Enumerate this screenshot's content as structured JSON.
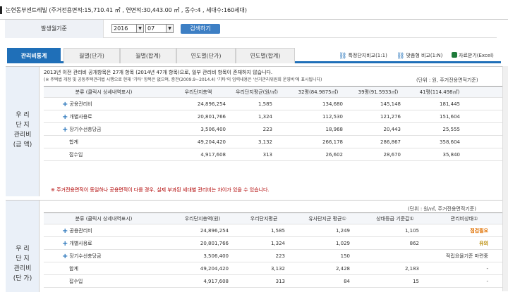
{
  "header": {
    "title": "논현동부센트레빌 (주거전용면적:15,710.41 ㎡ , 연면적:30,443.00 ㎡ , 동수:4 , 세대수:160세대)"
  },
  "filter": {
    "label": "발생월기준",
    "year": "2016",
    "month": "07",
    "search_label": "검색하기"
  },
  "tabs": [
    {
      "label": "관리비통계"
    },
    {
      "label": "월별(단가)"
    },
    {
      "label": "월별(합계)"
    },
    {
      "label": "연도별(단가)"
    },
    {
      "label": "연도별(합계)"
    }
  ],
  "links": {
    "special": "특정단지비교(1:1)",
    "custom": "맞춤형 비교(1:N)",
    "excel": "자료받기(Excel)"
  },
  "section1": {
    "side_label": [
      "우 리",
      "단 지",
      "관리비",
      "(금 액)"
    ],
    "notice": "2013년 이전 관리비 공개항목은 27개 항목 (2014년 47개 항목)으로, 일부 관리비 항목이 존재하지 않습니다.",
    "subnotice": "(※ 주택법 개정 및 공동주택관리법 시행으로 현재 '기타' 항목은 없으며, 종전(2009.9~2014.4) '기타'의 입력내용은 '선거관리위원회 운영비'에 표시됩니다)",
    "unit": "(단위 : 원, 주거전용면적기준)",
    "headers": [
      "분류 (클릭시 상세내역표시)",
      "우리단지총액",
      "우리단지평균(원/㎡)",
      "32평(84.9875㎡)",
      "39평(91.5933㎡)",
      "41평(114.498㎡)"
    ],
    "rows": [
      {
        "name": "공용관리비",
        "total": "24,896,254",
        "avg": "1,585",
        "p32": "134,680",
        "p39": "145,148",
        "p41": "181,445"
      },
      {
        "name": "개별사용료",
        "total": "20,801,766",
        "avg": "1,324",
        "p32": "112,530",
        "p39": "121,276",
        "p41": "151,604"
      },
      {
        "name": "장기수선충당금",
        "total": "3,506,400",
        "avg": "223",
        "p32": "18,968",
        "p39": "20,443",
        "p41": "25,555"
      },
      {
        "name": "합계",
        "total": "49,204,420",
        "avg": "3,132",
        "p32": "266,178",
        "p39": "286,867",
        "p41": "358,604"
      },
      {
        "name": "잡수입",
        "total": "4,917,608",
        "avg": "313",
        "p32": "26,602",
        "p39": "28,670",
        "p41": "35,840"
      }
    ],
    "warning": "※ 주거전용면적이 동일하나 공용면적이 다를 경우, 실제 부과된 세대별 관리비는 차이가 있을 수 있습니다."
  },
  "section2": {
    "side_label": [
      "우 리",
      "단 지",
      "관리비",
      "(단 가)"
    ],
    "unit": "(단위 : 원/㎡, 주거전용면적기준)",
    "headers": [
      "분류 (클릭시 상세내역표시)",
      "우리단지총액(원)",
      "우리단지평균",
      "유사단지군 평균①",
      "상태등급 기준값①",
      "관리비상태①"
    ],
    "rows": [
      {
        "name": "공용관리비",
        "total": "24,896,254",
        "avg": "1,585",
        "similar": "1,249",
        "grade": "1,105",
        "status": "점검필요"
      },
      {
        "name": "개별사용료",
        "total": "20,801,766",
        "avg": "1,324",
        "similar": "1,029",
        "grade": "862",
        "status": "유의"
      },
      {
        "name": "장기수선충당금",
        "total": "3,506,400",
        "avg": "223",
        "similar": "150",
        "grade": "",
        "status": "적립요율기준 마련중"
      },
      {
        "name": "합계",
        "total": "49,204,420",
        "avg": "3,132",
        "similar": "2,428",
        "grade": "2,183",
        "status": "-"
      },
      {
        "name": "잡수입",
        "total": "4,917,608",
        "avg": "313",
        "similar": "84",
        "grade": "15",
        "status": "-"
      }
    ]
  }
}
